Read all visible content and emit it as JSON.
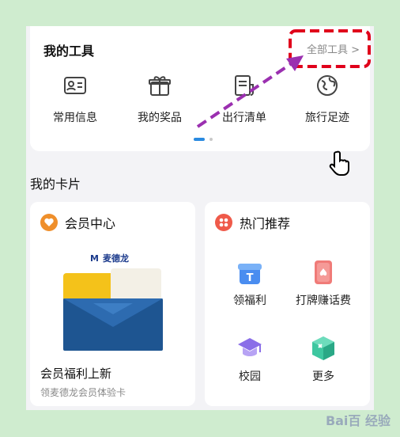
{
  "tools": {
    "title": "我的工具",
    "all_tools_label": "全部工具 >",
    "items": [
      {
        "label": "常用信息",
        "icon": "id-card-icon"
      },
      {
        "label": "我的奖品",
        "icon": "gift-box-icon"
      },
      {
        "label": "出行清单",
        "icon": "checklist-icon"
      },
      {
        "label": "旅行足迹",
        "icon": "globe-icon"
      }
    ]
  },
  "cards_section": {
    "title": "我的卡片"
  },
  "member_card": {
    "title": "会员中心",
    "brand": "麦德龙",
    "promo_title": "会员福利上新",
    "promo_subtitle": "领麦德龙会员体验卡",
    "accent": "#ef8f2b"
  },
  "hot_card": {
    "title": "热门推荐",
    "accent": "#ef5a4a",
    "items": [
      {
        "label": "领福利",
        "icon": "gift-icon"
      },
      {
        "label": "打牌赚话费",
        "icon": "playing-card-icon"
      },
      {
        "label": "校园",
        "icon": "graduation-cap-icon"
      },
      {
        "label": "更多",
        "icon": "more-cube-icon"
      }
    ]
  },
  "colors": {
    "highlight": "#e0001b",
    "arrow": "#9b30b0",
    "page_indicator": "#2a8ae0"
  }
}
